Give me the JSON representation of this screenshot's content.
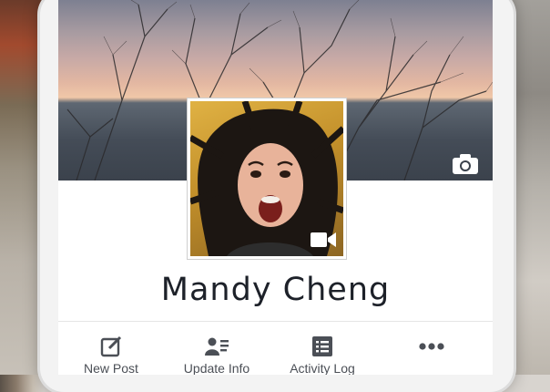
{
  "profile": {
    "name": "Mandy Cheng"
  },
  "actions": [
    {
      "label": "New Post",
      "icon": "compose-icon"
    },
    {
      "label": "Update Info",
      "icon": "update-info-icon"
    },
    {
      "label": "Activity Log",
      "icon": "activity-log-icon"
    },
    {
      "label": "",
      "icon": "more-icon"
    }
  ],
  "icons": {
    "cover": "camera-icon",
    "profile_video": "video-camera-icon"
  },
  "colors": {
    "name_text": "#1d2129",
    "action_icon": "#4b4f56"
  }
}
